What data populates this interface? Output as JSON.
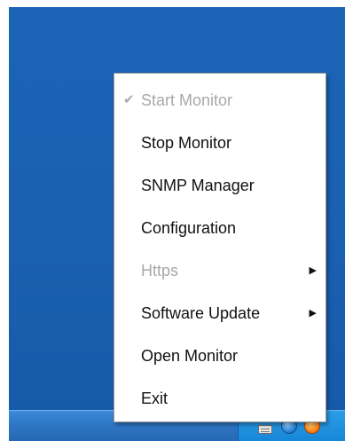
{
  "menu": {
    "items": [
      {
        "label": "Start Monitor",
        "checked": true,
        "enabled": false,
        "submenu": false
      },
      {
        "label": "Stop Monitor",
        "checked": false,
        "enabled": true,
        "submenu": false
      },
      {
        "label": "SNMP Manager",
        "checked": false,
        "enabled": true,
        "submenu": false
      },
      {
        "label": "Configuration",
        "checked": false,
        "enabled": true,
        "submenu": false
      },
      {
        "label": "Https",
        "checked": false,
        "enabled": false,
        "submenu": true
      },
      {
        "label": "Software Update",
        "checked": false,
        "enabled": true,
        "submenu": true
      },
      {
        "label": "Open Monitor",
        "checked": false,
        "enabled": true,
        "submenu": false
      },
      {
        "label": "Exit",
        "checked": false,
        "enabled": true,
        "submenu": false
      }
    ]
  },
  "tray": {
    "icons": [
      "keyboard-icon",
      "network-icon",
      "monitor-app-icon"
    ]
  },
  "colors": {
    "desktop": "#1a60b0",
    "taskbar": "#2f78c6",
    "menu_bg": "#ffffff",
    "menu_text": "#111111",
    "disabled_text": "#a8a8a8"
  }
}
